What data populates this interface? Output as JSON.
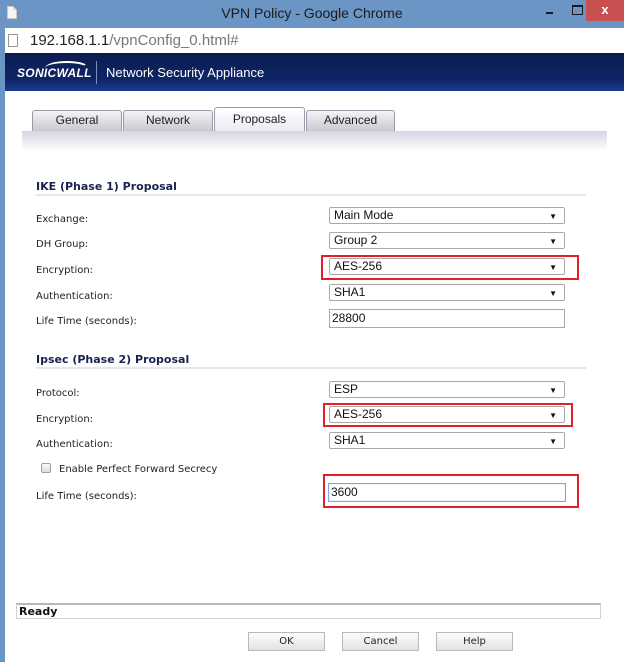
{
  "window": {
    "title": "VPN Policy - Google Chrome",
    "close_glyph": "x"
  },
  "address_bar": {
    "host": "192.168.1.1",
    "path": "/vpnConfig_0.html#"
  },
  "banner": {
    "logo": "SONICWALL",
    "product": "Network Security Appliance"
  },
  "tabs": [
    {
      "label": "General",
      "active": false
    },
    {
      "label": "Network",
      "active": false
    },
    {
      "label": "Proposals",
      "active": true
    },
    {
      "label": "Advanced",
      "active": false
    }
  ],
  "ike": {
    "title": "IKE (Phase 1) Proposal",
    "exchange": {
      "label": "Exchange:",
      "value": "Main Mode"
    },
    "dh_group": {
      "label": "DH Group:",
      "value": "Group 2"
    },
    "encryption": {
      "label": "Encryption:",
      "value": "AES-256",
      "highlighted": true
    },
    "authentication": {
      "label": "Authentication:",
      "value": "SHA1"
    },
    "lifetime": {
      "label": "Life Time (seconds):",
      "value": "28800"
    }
  },
  "ipsec": {
    "title": "Ipsec (Phase 2) Proposal",
    "protocol": {
      "label": "Protocol:",
      "value": "ESP"
    },
    "encryption": {
      "label": "Encryption:",
      "value": "AES-256",
      "highlighted": true
    },
    "authentication": {
      "label": "Authentication:",
      "value": "SHA1"
    },
    "pfs": {
      "label": "Enable Perfect Forward Secrecy",
      "checked": false
    },
    "lifetime": {
      "label": "Life Time (seconds):",
      "value": "3600",
      "highlighted": true
    }
  },
  "status": "Ready",
  "buttons": {
    "ok": "OK",
    "cancel": "Cancel",
    "help": "Help"
  },
  "colors": {
    "highlight": "#e2202a",
    "banner": "#0d2466",
    "window_frame": "#6b95c4",
    "close_button": "#c75050"
  }
}
